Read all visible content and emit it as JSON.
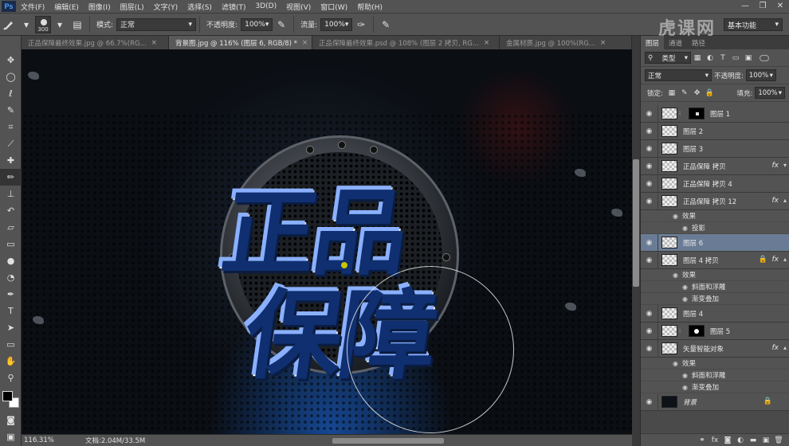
{
  "app": {
    "logo": "Ps"
  },
  "menu": [
    "文件(F)",
    "编辑(E)",
    "图像(I)",
    "图层(L)",
    "文字(Y)",
    "选择(S)",
    "滤镜(T)",
    "3D(D)",
    "视图(V)",
    "窗口(W)",
    "帮助(H)"
  ],
  "window_controls": {
    "minimize": "—",
    "restore": "❐",
    "close": "✕"
  },
  "options": {
    "brush_size": "300",
    "mode_label": "模式:",
    "mode_value": "正常",
    "opacity_label": "不透明度:",
    "opacity_value": "100%",
    "flow_label": "流量:",
    "flow_value": "100%",
    "workspace": "基本功能",
    "watermark": "虎课网"
  },
  "tabs": [
    {
      "label": "正品保障最终效果.jpg @ 66.7%(RG...",
      "active": false
    },
    {
      "label": "背景图.jpg @ 116% (图层 6, RGB/8) *",
      "active": true
    },
    {
      "label": "正品保障最终效果.psd @ 108% (图层 2 拷贝, RG...",
      "active": false
    },
    {
      "label": "金属材质.jpg @ 100%(RG...",
      "active": false
    }
  ],
  "canvas": {
    "line1": "正品",
    "line2": "保障"
  },
  "status": {
    "zoom": "116.31%",
    "doc": "文档:2.04M/33.5M"
  },
  "panel": {
    "tabs": [
      "图层",
      "通道",
      "路径"
    ],
    "filter_label": "类型",
    "blend_mode": "正常",
    "opacity_label": "不透明度:",
    "opacity_value": "100%",
    "lock_label": "锁定:",
    "fill_label": "填充:",
    "fill_value": "100%"
  },
  "layers": [
    {
      "name": "图层 1",
      "has_mask": true,
      "fx": false
    },
    {
      "name": "图层 2",
      "fx": false
    },
    {
      "name": "图层 3",
      "fx": false
    },
    {
      "name": "正品保障 拷贝",
      "fx": true
    },
    {
      "name": "正品保障 拷贝 4",
      "fx": false
    },
    {
      "name": "正品保障 拷贝 12",
      "fx": true,
      "effects_label": "效果",
      "effects": [
        "投影"
      ]
    },
    {
      "name": "图层 6",
      "fx": false,
      "selected": true
    },
    {
      "name": "图层 4 拷贝",
      "fx": true,
      "locked": true,
      "effects_label": "效果",
      "effects": [
        "斜面和浮雕",
        "渐变叠加"
      ]
    },
    {
      "name": "图层 4",
      "fx": false
    },
    {
      "name": "图层 5",
      "fx": false,
      "has_mask": true
    },
    {
      "name": "矢量智能对象",
      "fx": true,
      "effects_label": "效果",
      "effects": [
        "斜面和浮雕",
        "渐变叠加"
      ]
    },
    {
      "name": "背景",
      "fx": false,
      "background": true
    }
  ],
  "fx_label": "fx",
  "colors": {
    "accent": "#6a7c95",
    "panel": "#535353",
    "canvas": "#0b0e13"
  }
}
